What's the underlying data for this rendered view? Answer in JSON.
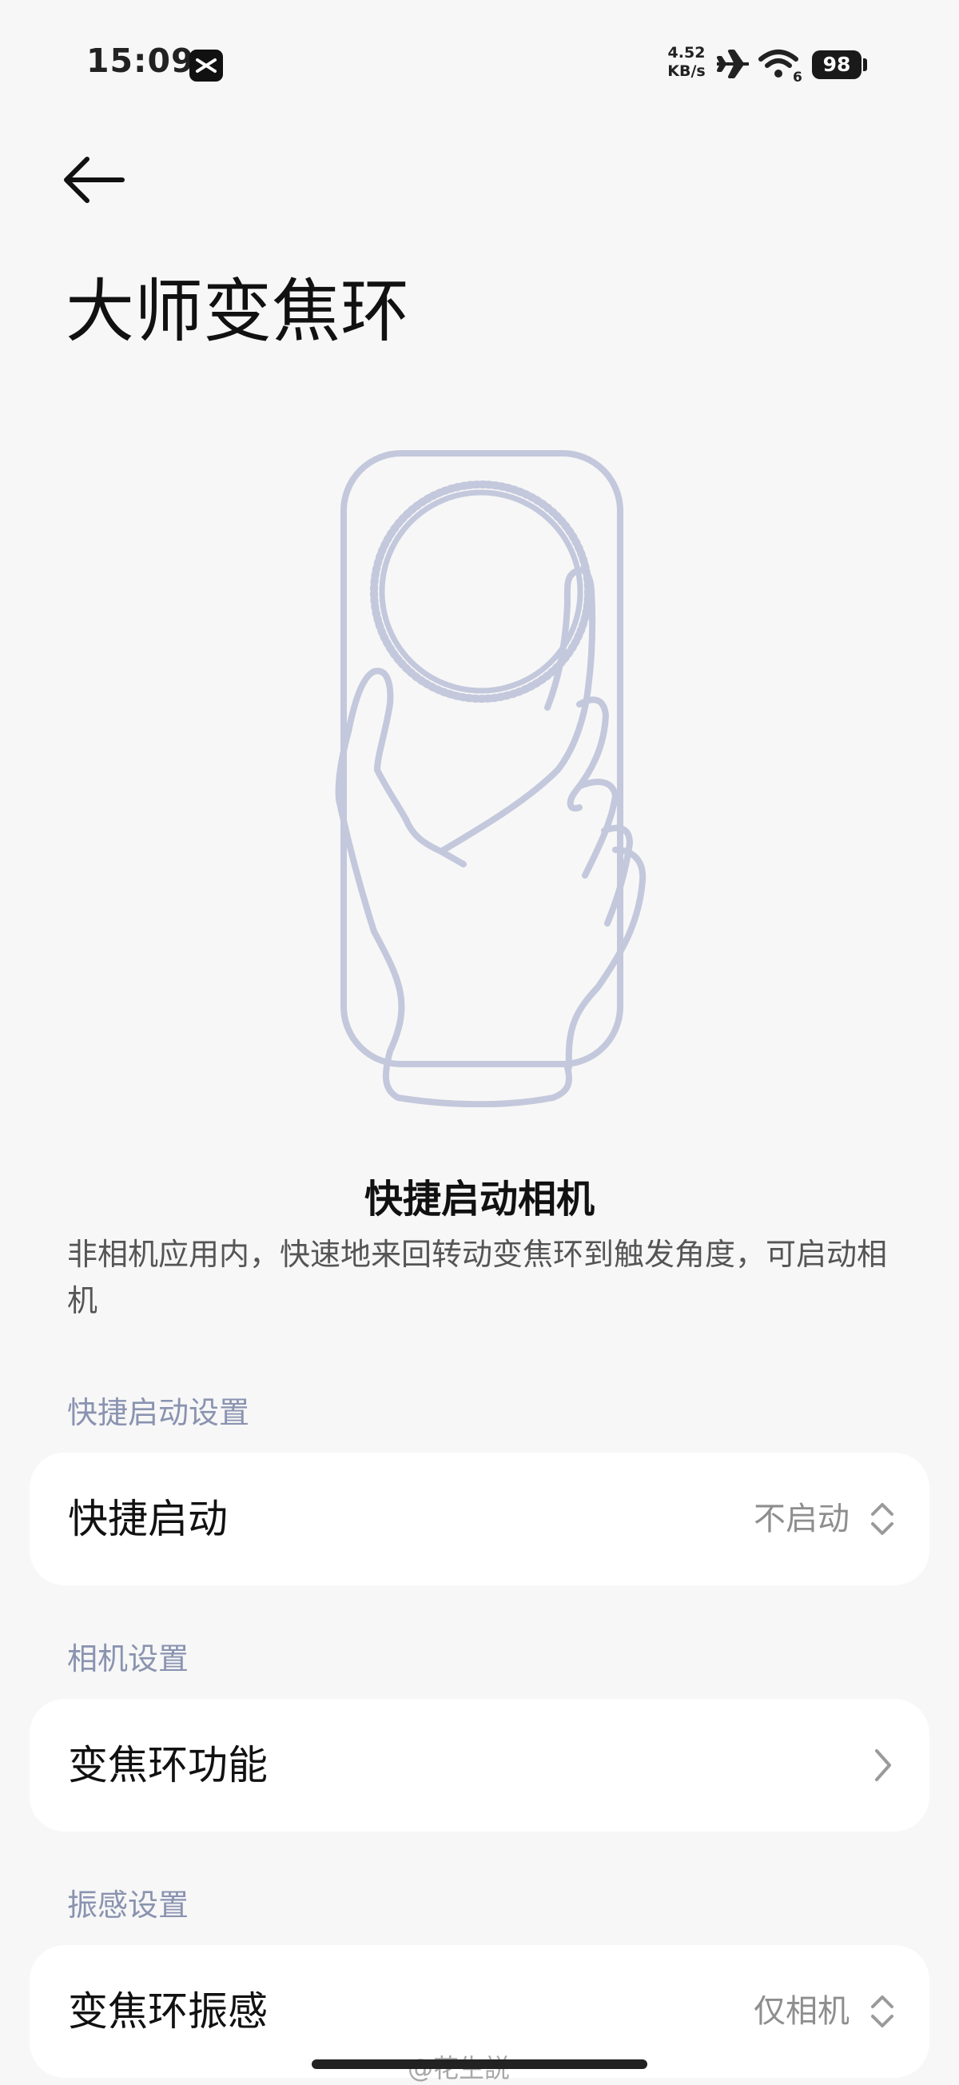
{
  "status_bar": {
    "time": "15:09",
    "net_speed_value": "4.52",
    "net_speed_unit": "KB/s",
    "wifi_badge": "6",
    "battery": "98",
    "icons": [
      "app-notification-icon",
      "airplane-icon",
      "wifi-icon",
      "battery-icon"
    ]
  },
  "header": {
    "back_icon": "arrow-left-icon",
    "title": "大师变焦环"
  },
  "feature": {
    "title": "快捷启动相机",
    "description": "非相机应用内，快速地来回转动变焦环到触发角度，可启动相机"
  },
  "sections": [
    {
      "label": "快捷启动设置",
      "item": {
        "label": "快捷启动",
        "value": "不启动",
        "icon": "chevron-up-down-icon"
      }
    },
    {
      "label": "相机设置",
      "item": {
        "label": "变焦环功能",
        "value": "",
        "icon": "chevron-right-icon"
      }
    },
    {
      "label": "振感设置",
      "item": {
        "label": "变焦环振感",
        "value": "仅相机",
        "icon": "chevron-up-down-icon"
      }
    }
  ],
  "watermark": "@花生説",
  "colors": {
    "background": "#f7f7f7",
    "card": "#ffffff",
    "section_label": "#8a93b0",
    "illustration_stroke": "#c3c8dc"
  }
}
